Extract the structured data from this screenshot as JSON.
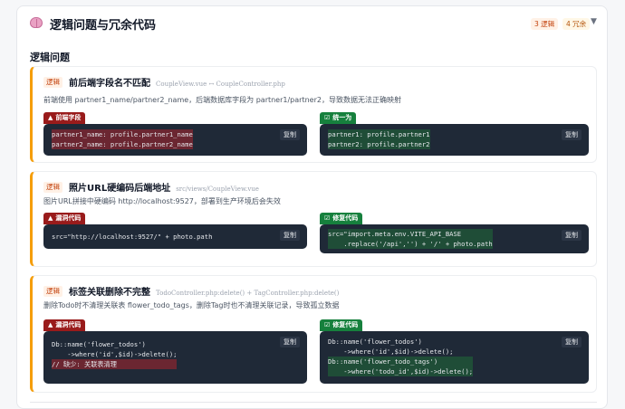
{
  "header": {
    "title": "逻辑问题与冗余代码",
    "badge_logic": "3 逻辑",
    "badge_redundant": "4 冗余",
    "collapse_icon": "chevron-down-icon",
    "title_icon": "brain-icon"
  },
  "section": {
    "title": "逻辑问题"
  },
  "colors": {
    "accent": "#f59e0b",
    "bad": "#991b1b",
    "good": "#16803d",
    "code_bg": "#1f2937"
  },
  "issues": [
    {
      "tag": "逻辑",
      "title": "前后端字段名不匹配",
      "file": "CoupleView.vue ↔ CoupleController.php",
      "desc": "前端使用 partner1_name/partner2_name，后端数据库字段为 partner1/partner2，导致数据无法正确映射",
      "left": {
        "label": "前端字段",
        "copy": "复制",
        "lines": [
          "partner1_name: profile.partner1_name",
          "partner2_name: profile.partner2_name"
        ]
      },
      "right": {
        "label": "统一为",
        "copy": "复制",
        "lines": [
          "partner1: profile.partner1",
          "partner2: profile.partner2"
        ]
      }
    },
    {
      "tag": "逻辑",
      "title": "照片URL硬编码后端地址",
      "file": "src/views/CoupleView.vue",
      "desc": "图片URL拼接中硬编码 http://localhost:9527，部署到生产环境后会失效",
      "left": {
        "label": "漏洞代码",
        "copy": "复制",
        "lines": [
          "src=\"http://localhost:9527/\" + photo.path"
        ]
      },
      "right": {
        "label": "修复代码",
        "copy": "复制",
        "lines": [
          "src=\"import.meta.env.VITE_API_BASE",
          "    .replace('/api','') + '/' + photo.path"
        ]
      }
    },
    {
      "tag": "逻辑",
      "title": "标签关联删除不完整",
      "file": "TodoController.php:delete() + TagController.php:delete()",
      "desc": "删除Todo时不清理关联表 flower_todo_tags，删除Tag时也不清理关联记录，导致孤立数据",
      "left": {
        "label": "漏洞代码",
        "copy": "复制",
        "lines": [
          "Db::name('flower_todos')",
          "    ->where('id',$id)->delete();",
          "// 缺少: 关联表清理"
        ]
      },
      "right": {
        "label": "修复代码",
        "copy": "复制",
        "lines": [
          "Db::name('flower_todos')",
          "    ->where('id',$id)->delete();",
          "Db::name('flower_todo_tags')",
          "    ->where('todo_id',$id)->delete();"
        ]
      }
    }
  ]
}
